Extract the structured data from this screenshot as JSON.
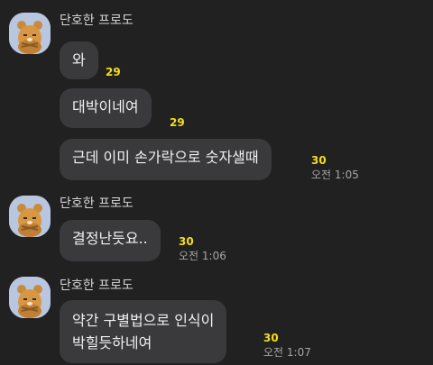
{
  "groups": [
    {
      "sender": "단호한 프로도",
      "avatar_icon": "ryan-character-icon",
      "messages": [
        {
          "text": "와",
          "unread": "29",
          "time": ""
        },
        {
          "text": "대박이네여",
          "unread": "29",
          "time": ""
        },
        {
          "text": "근데 이미 손가락으로 숫자샐때",
          "unread": "30",
          "time": "오전 1:05"
        }
      ]
    },
    {
      "sender": "단호한 프로도",
      "avatar_icon": "ryan-character-icon",
      "messages": [
        {
          "text": "결정난듯요..",
          "unread": "30",
          "time": "오전 1:06"
        }
      ]
    },
    {
      "sender": "단호한 프로도",
      "avatar_icon": "ryan-character-icon",
      "messages": [
        {
          "lines": [
            "약간 구별법으로 인식이",
            "박힐듯하네여"
          ],
          "unread": "30",
          "time": "오전 1:07"
        }
      ]
    }
  ],
  "colors": {
    "background": "#212121",
    "bubble": "#3a3a3c",
    "unread": "#f5dd1d",
    "avatar_bg": "#b9c6e0"
  }
}
